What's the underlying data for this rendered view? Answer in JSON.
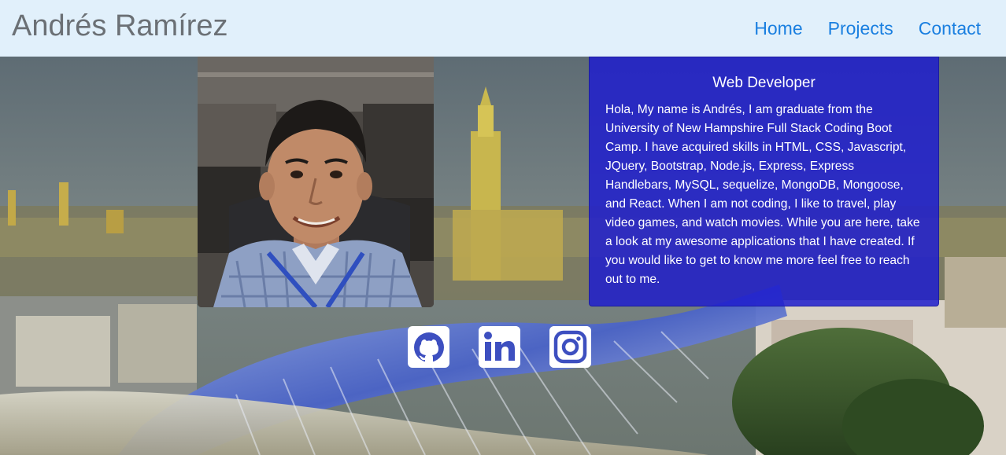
{
  "navbar": {
    "brand": "Andrés Ramírez",
    "links": [
      "Home",
      "Projects",
      "Contact"
    ]
  },
  "card": {
    "title": "Web Developer",
    "text": "Hola, My name is Andrés, I am graduate from the University of New Hampshire Full Stack Coding Boot Camp. I have acquired skills in HTML, CSS, Javascript, JQuery, Bootstrap, Node.js, Express, Express Handlebars, MySQL, sequelize, MongoDB, Mongoose, and React. When I am not coding, I like to travel, play video games, and watch movies. While you are here, take a look at my awesome applications that I have created. If you would like to get to know me more feel free to reach out to me."
  },
  "social": {
    "icons": [
      "github-icon",
      "linkedin-icon",
      "instagram-icon"
    ]
  },
  "colors": {
    "navbar_bg": "#e1f0fb",
    "nav_link": "#1a7fe0",
    "brand_text": "#6b7075",
    "card_bg": "#201ecd",
    "icon_blue": "#3d4fc0"
  }
}
